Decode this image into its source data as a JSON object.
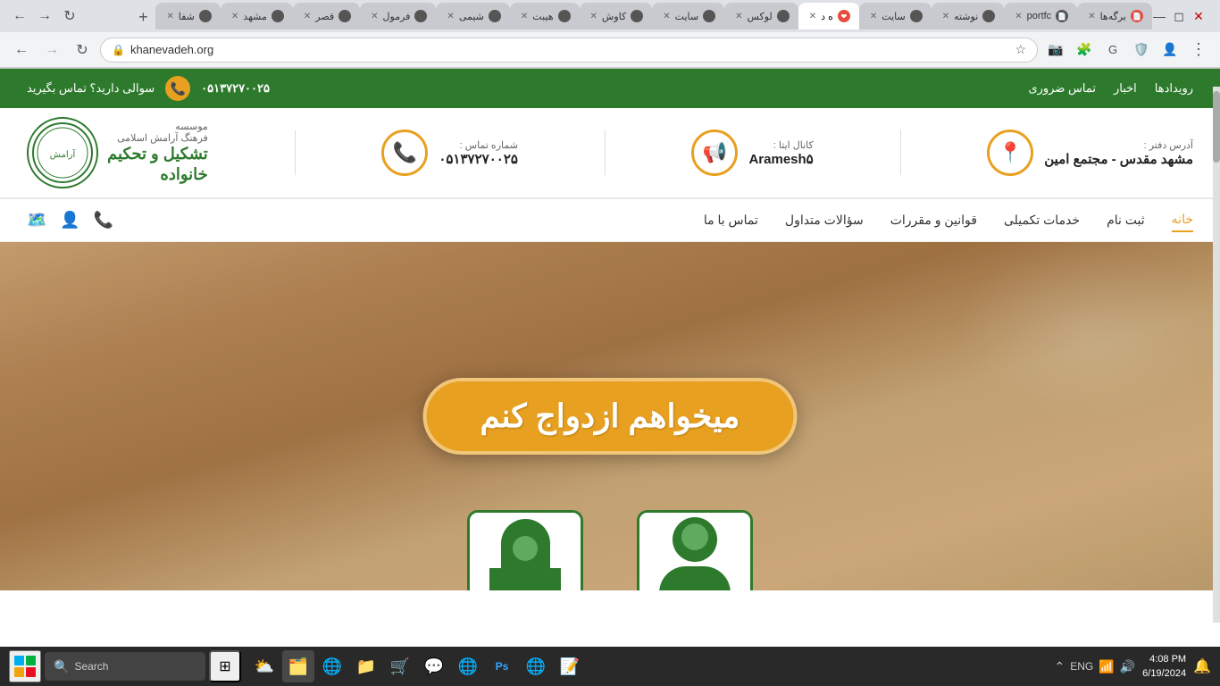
{
  "browser": {
    "tabs": [
      {
        "label": "برگه‌ها",
        "favicon": "📄",
        "active": false
      },
      {
        "label": "portfc",
        "favicon": "📄",
        "active": false
      },
      {
        "label": "نوشته",
        "favicon": "📄",
        "active": false
      },
      {
        "label": "سایت",
        "favicon": "📄",
        "active": false
      },
      {
        "label": "ه د",
        "favicon": "❤️",
        "active": true
      },
      {
        "label": "لوکس",
        "favicon": "📄",
        "active": false
      },
      {
        "label": "سایت",
        "favicon": "📄",
        "active": false
      },
      {
        "label": "کاوش",
        "favicon": "📄",
        "active": false
      },
      {
        "label": "هیبت",
        "favicon": "📄",
        "active": false
      },
      {
        "label": "شیمی",
        "favicon": "📄",
        "active": false
      },
      {
        "label": "فرمول",
        "favicon": "📄",
        "active": false
      },
      {
        "label": "قصر",
        "favicon": "📄",
        "active": false
      },
      {
        "label": "مشهد",
        "favicon": "📄",
        "active": false
      },
      {
        "label": "شفا",
        "favicon": "📄",
        "active": false
      }
    ],
    "url": "khanevadeh.org",
    "new_tab_label": "+"
  },
  "site": {
    "topbar": {
      "phone": "۰۵۱۳۷۲۷۰۰۲۵",
      "contact_cta": "سوالی دارید؟ تماس بگیرید",
      "nav_links": [
        "رویدادها",
        "اخبار",
        "تماس ضروری"
      ]
    },
    "info_bar": {
      "phone_label": "شماره تماس :",
      "phone_value": "۰۵۱۳۷۲۷۰۰۲۵",
      "channel_label": "کانال ایتا :",
      "channel_value": "Aramesh۵",
      "address_label": "آدرس دفتر :",
      "address_value": "مشهد مقدس - مجتمع امین"
    },
    "logo": {
      "title": "تشکیل و تحکیم\nخانواده",
      "subtitle": "موسسه\nفرهنگ آرامش اسلامی"
    },
    "nav": {
      "items": [
        "خانه",
        "ثبت نام",
        "خدمات تکمیلی",
        "قوانین و مقررات",
        "سؤالات متداول",
        "تماس با ما"
      ]
    },
    "hero": {
      "cta_button": "میخواهم ازدواج کنم"
    }
  },
  "taskbar": {
    "search_placeholder": "Search",
    "clock": {
      "time": "4:08 PM",
      "date": "6/19/2024"
    },
    "language": "ENG",
    "apps": [
      "🗂️",
      "🌐",
      "📁",
      "🛒",
      "💬",
      "🌐",
      "🌐",
      "📝"
    ]
  }
}
